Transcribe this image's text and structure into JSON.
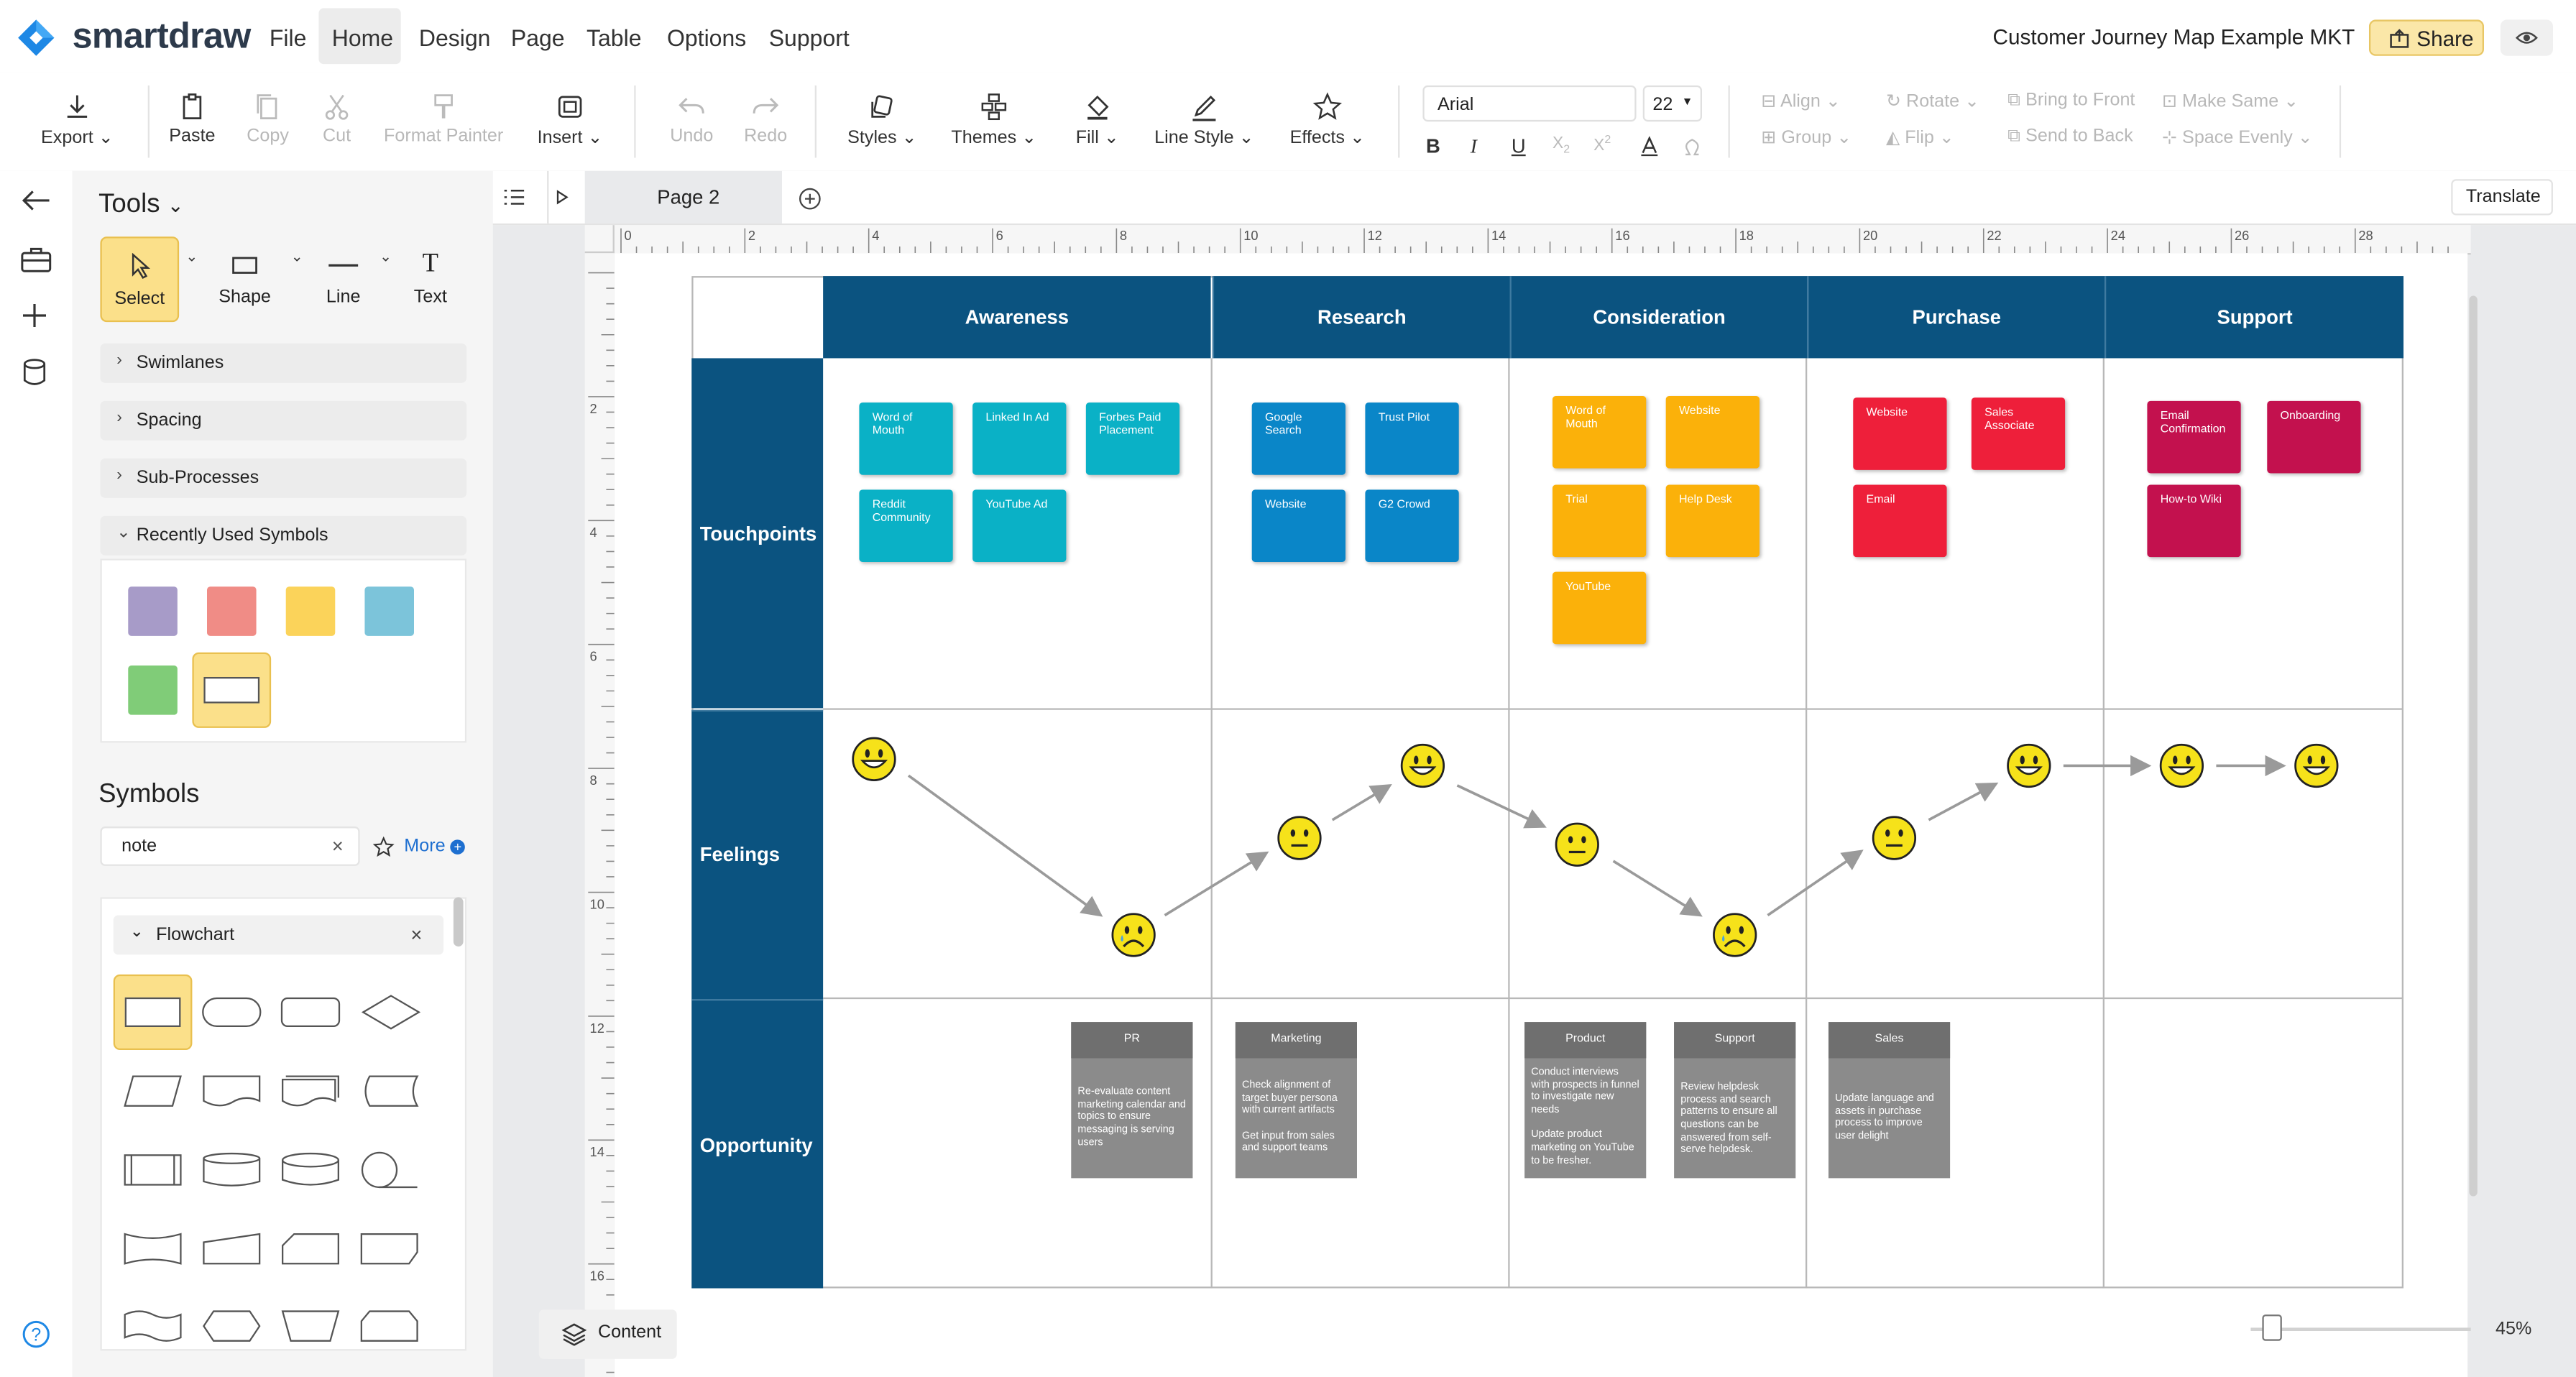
{
  "app": {
    "logo": "smartdraw",
    "document_title": "Customer Journey Map Example MKT"
  },
  "menu": {
    "file": "File",
    "home": "Home",
    "design": "Design",
    "page": "Page",
    "table": "Table",
    "options": "Options",
    "support": "Support",
    "share": "Share"
  },
  "toolbar": {
    "export": "Export",
    "paste": "Paste",
    "copy": "Copy",
    "cut": "Cut",
    "format_painter": "Format Painter",
    "insert": "Insert",
    "undo": "Undo",
    "redo": "Redo",
    "styles": "Styles",
    "themes": "Themes",
    "fill": "Fill",
    "line_style": "Line Style",
    "effects": "Effects",
    "font": "Arial",
    "font_size": "22",
    "align": "Align",
    "rotate": "Rotate",
    "bring_to_front": "Bring to Front",
    "make_same": "Make Same",
    "group": "Group",
    "flip": "Flip",
    "send_to_back": "Send to Back",
    "space_evenly": "Space Evenly"
  },
  "panel": {
    "tools_title": "Tools",
    "tools": {
      "select": "Select",
      "shape": "Shape",
      "line": "Line",
      "text": "Text"
    },
    "sections": {
      "swimlanes": "Swimlanes",
      "spacing": "Spacing",
      "sub_processes": "Sub-Processes",
      "recently_used": "Recently Used Symbols"
    },
    "recent_colors": [
      "#a79bc8",
      "#f08c86",
      "#fbd35a",
      "#7cc4da",
      "#80cc78"
    ],
    "symbols_title": "Symbols",
    "search_value": "note",
    "more": "More",
    "library": "Flowchart"
  },
  "canvas": {
    "page_tab": "Page 2",
    "translate": "Translate",
    "content_button": "Content",
    "zoom": "45%",
    "ruler_h": [
      "0",
      "2",
      "4",
      "6",
      "8",
      "10",
      "12",
      "14",
      "16",
      "18",
      "20",
      "22",
      "24",
      "26",
      "28"
    ],
    "ruler_v": [
      "2",
      "4",
      "6",
      "8",
      "10",
      "12",
      "14",
      "16"
    ]
  },
  "journey_map": {
    "stages": [
      "Awareness",
      "Research",
      "Consideration",
      "Purchase",
      "Support"
    ],
    "rows": {
      "touchpoints": "Touchpoints",
      "feelings": "Feelings",
      "opportunity": "Opportunity"
    },
    "touchpoints": {
      "awareness": [
        "Word of Mouth",
        "Linked In Ad",
        "Forbes Paid Placement",
        "Reddit Community",
        "YouTube Ad"
      ],
      "research": [
        "Google Search",
        "Trust Pilot",
        "Website",
        "G2 Crowd"
      ],
      "consideration": [
        "Word of Mouth",
        "Website",
        "Trial",
        "Help Desk",
        "YouTube"
      ],
      "purchase": [
        "Website",
        "Sales Associate",
        "Email"
      ],
      "support": [
        "Email Confirmation",
        "Onboarding",
        "How-to Wiki"
      ]
    },
    "note_colors": {
      "awareness": "#0ab1c6",
      "research": "#0a86c8",
      "consideration": "#fbb10a",
      "purchase": "#ee1f3a",
      "support": "#c3114e"
    },
    "feelings": [
      "happy",
      "sad",
      "neutral",
      "happy",
      "neutral",
      "sad",
      "neutral",
      "happy",
      "happy",
      "happy"
    ],
    "opportunities": [
      {
        "title": "PR",
        "body": "Re-evaluate content marketing calendar and topics to ensure messaging is serving users"
      },
      {
        "title": "Marketing",
        "body": "Check alignment of target buyer persona with current artifacts\n\nGet input from sales and support teams"
      },
      {
        "title": "Product",
        "body": "Conduct interviews with prospects in funnel to investigate new needs\n\nUpdate product marketing on YouTube to be fresher."
      },
      {
        "title": "Support",
        "body": "Review helpdesk process and search patterns to ensure all questions can be answered from self-serve helpdesk."
      },
      {
        "title": "Sales",
        "body": "Update language and assets in purchase process to improve user delight"
      }
    ]
  }
}
